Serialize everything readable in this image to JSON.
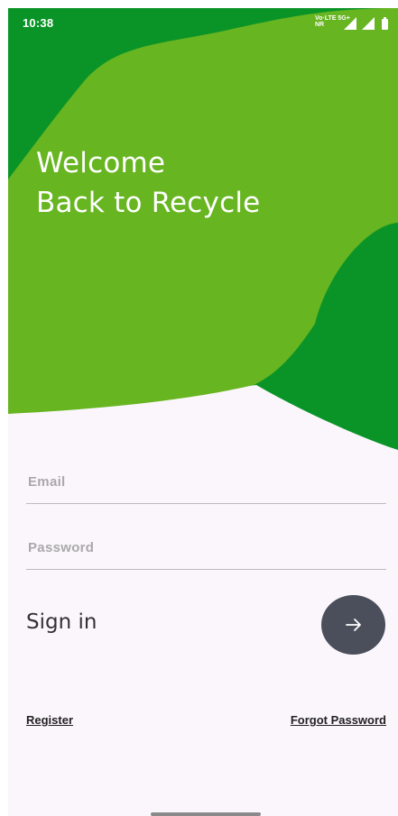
{
  "colors": {
    "dark_green": "#0a9427",
    "light_green": "#67b520",
    "background": "#fbf6fc",
    "button_dark": "#4a4f5b",
    "text_white": "#ffffff"
  },
  "status_bar": {
    "time": "10:38",
    "network_line1": "Vo·LTE 5G+",
    "network_line2": "NR",
    "icons": [
      "signal-icon",
      "signal-icon",
      "battery-icon"
    ]
  },
  "hero": {
    "line1": "Welcome",
    "line2": "Back to Recycle"
  },
  "form": {
    "email_placeholder": "Email",
    "password_placeholder": "Password",
    "email_value": "",
    "password_value": ""
  },
  "signin": {
    "label": "Sign in",
    "button_icon": "arrow-right-icon"
  },
  "links": {
    "register": "Register",
    "forgot_password": "Forgot Password"
  }
}
